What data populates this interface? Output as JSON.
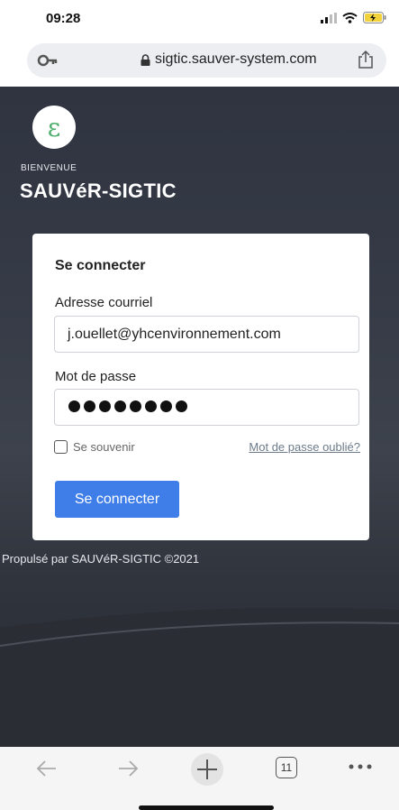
{
  "status": {
    "time": "09:28"
  },
  "browser": {
    "url": "sigtic.sauver-system.com",
    "tab_count": "11"
  },
  "page": {
    "welcome": "BIENVENUE",
    "app_title": "SAUVéR-SIGTIC",
    "logo_letter": "ε",
    "form": {
      "title": "Se connecter",
      "email_label": "Adresse courriel",
      "email_value": "j.ouellet@yhcenvironnement.com",
      "password_label": "Mot de passe",
      "remember_label": "Se souvenir",
      "forgot_link": "Mot de passe oublié?",
      "submit_label": "Se connecter"
    },
    "footer": "Propulsé par SAUVéR-SIGTIC ©2021"
  },
  "colors": {
    "primary": "#3f7ee8",
    "page_bg": "#353a46"
  },
  "icons": [
    "signal-icon",
    "wifi-icon",
    "battery-icon",
    "key-icon",
    "lock-icon",
    "share-icon",
    "back-icon",
    "forward-icon",
    "new-tab-icon",
    "tabs-icon",
    "more-icon"
  ]
}
